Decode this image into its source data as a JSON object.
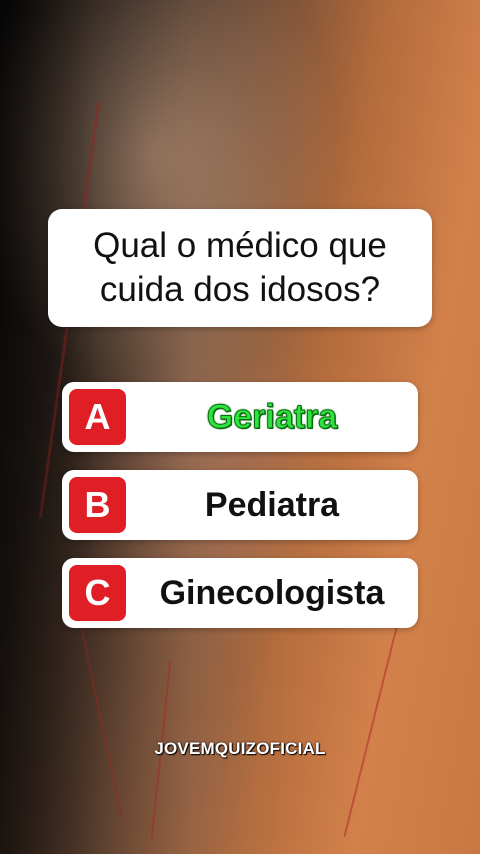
{
  "question": {
    "line1": "Qual o médico que",
    "line2": "cuida dos idosos?"
  },
  "options": [
    {
      "letter": "A",
      "label": "Geriatra",
      "correct": true
    },
    {
      "letter": "B",
      "label": "Pediatra",
      "correct": false
    },
    {
      "letter": "C",
      "label": "Ginecologista",
      "correct": false
    }
  ],
  "watermark": "JOVEMQUIZOFICIAL",
  "colors": {
    "badge": "#e01e26",
    "correct_text": "#2ee33b",
    "card": "#ffffff",
    "background_accent": "#d3814a"
  }
}
